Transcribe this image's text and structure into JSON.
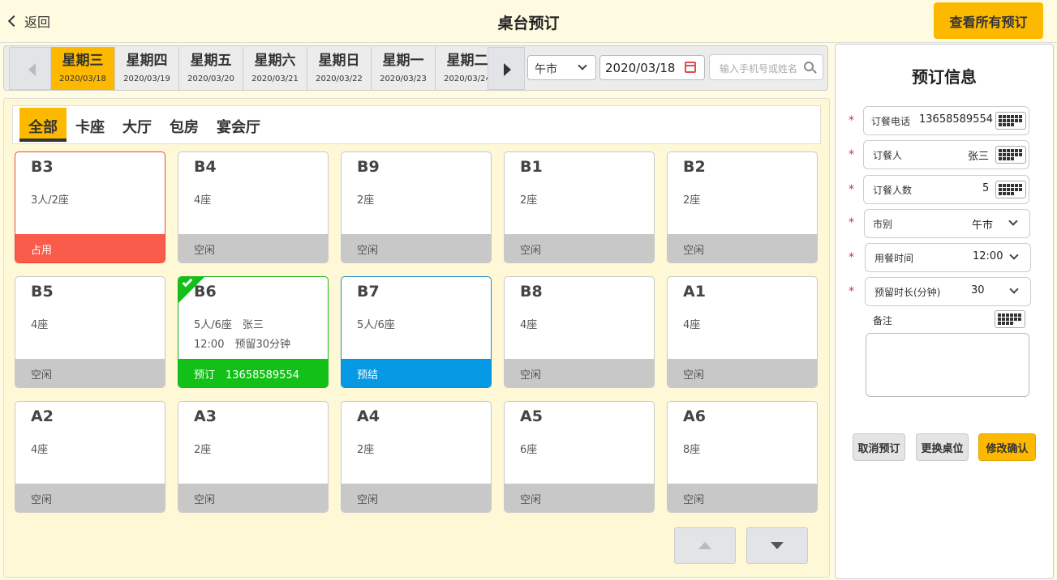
{
  "header": {
    "back_label": "返回",
    "title": "桌台预订",
    "view_all_label": "查看所有预订"
  },
  "days": [
    {
      "weekday": "星期三",
      "date": "2020/03/18",
      "active": true
    },
    {
      "weekday": "星期四",
      "date": "2020/03/19",
      "active": false
    },
    {
      "weekday": "星期五",
      "date": "2020/03/20",
      "active": false
    },
    {
      "weekday": "星期六",
      "date": "2020/03/21",
      "active": false
    },
    {
      "weekday": "星期日",
      "date": "2020/03/22",
      "active": false
    },
    {
      "weekday": "星期一",
      "date": "2020/03/23",
      "active": false
    },
    {
      "weekday": "星期二",
      "date": "2020/03/24",
      "active": false
    }
  ],
  "filters": {
    "meal_value": "午市",
    "date_value": "2020/03/18",
    "search_placeholder": "输入手机号或姓名"
  },
  "categories": [
    "全部",
    "卡座",
    "大厅",
    "包房",
    "宴会厅"
  ],
  "tables": [
    {
      "name": "B3",
      "line1": "3人/2座",
      "line2": "",
      "status": "占用",
      "state": "occupied"
    },
    {
      "name": "B4",
      "line1": "4座",
      "line2": "",
      "status": "空闲",
      "state": "free"
    },
    {
      "name": "B9",
      "line1": "2座",
      "line2": "",
      "status": "空闲",
      "state": "free"
    },
    {
      "name": "B1",
      "line1": "2座",
      "line2": "",
      "status": "空闲",
      "state": "free"
    },
    {
      "name": "B2",
      "line1": "2座",
      "line2": "",
      "status": "空闲",
      "state": "free"
    },
    {
      "name": "B5",
      "line1": "4座",
      "line2": "",
      "status": "空闲",
      "state": "free"
    },
    {
      "name": "B6",
      "line1": "5人/6座　张三",
      "line2": "12:00　预留30分钟",
      "status": "预订　13658589554",
      "state": "reserved"
    },
    {
      "name": "B7",
      "line1": "5人/6座",
      "line2": "",
      "status": "预结",
      "state": "prepay"
    },
    {
      "name": "B8",
      "line1": "4座",
      "line2": "",
      "status": "空闲",
      "state": "free"
    },
    {
      "name": "A1",
      "line1": "4座",
      "line2": "",
      "status": "空闲",
      "state": "free"
    },
    {
      "name": "A2",
      "line1": "4座",
      "line2": "",
      "status": "空闲",
      "state": "free"
    },
    {
      "name": "A3",
      "line1": "2座",
      "line2": "",
      "status": "空闲",
      "state": "free"
    },
    {
      "name": "A4",
      "line1": "2座",
      "line2": "",
      "status": "空闲",
      "state": "free"
    },
    {
      "name": "A5",
      "line1": "6座",
      "line2": "",
      "status": "空闲",
      "state": "free"
    },
    {
      "name": "A6",
      "line1": "8座",
      "line2": "",
      "status": "空闲",
      "state": "free"
    }
  ],
  "panel": {
    "title": "预订信息",
    "phone_label": "订餐电话",
    "phone_value": "13658589554",
    "name_label": "订餐人",
    "name_value": "张三",
    "count_label": "订餐人数",
    "count_value": "5",
    "meal_label": "市别",
    "meal_value": "午市",
    "time_label": "用餐时间",
    "time_value": "12:00",
    "hold_label": "预留时长(分钟)",
    "hold_value": "30",
    "note_label": "备注",
    "cancel_label": "取消预订",
    "change_label": "更换桌位",
    "confirm_label": "修改确认"
  },
  "colors": {
    "accent": "#fdb900",
    "occupied": "#fa5c4b",
    "reserved": "#13c018",
    "prepay": "#0599e3",
    "free": "#c8c8c8"
  }
}
